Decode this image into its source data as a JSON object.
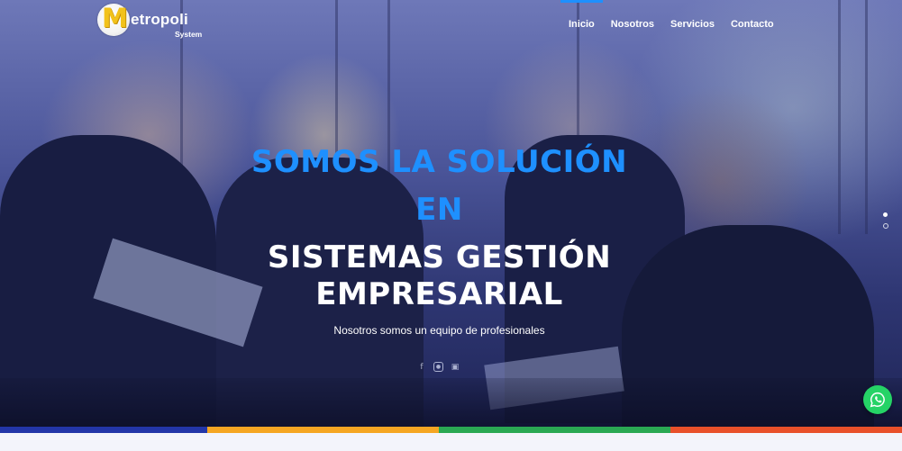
{
  "brand": {
    "logo_letter": "M",
    "name": "etropoli",
    "subtitle": "System"
  },
  "nav": {
    "items": [
      {
        "label": "Inicio",
        "active": true
      },
      {
        "label": "Nosotros",
        "active": false
      },
      {
        "label": "Servicios",
        "active": false
      },
      {
        "label": "Contacto",
        "active": false
      }
    ],
    "active_color": "#1e90ff"
  },
  "hero": {
    "line1": "SOMOS LA SOLUCIÓN",
    "line2": "EN",
    "line3": "SISTEMAS GESTIÓN",
    "line4": "EMPRESARIAL",
    "tagline": "Nosotros somos un equipo de profesionales",
    "accent_color": "#1e90ff",
    "social_icons": [
      "facebook-icon",
      "instagram-icon",
      "youtube-icon"
    ]
  },
  "slider": {
    "slide_count": 2,
    "active_slide": 1
  },
  "whatsapp": {
    "icon": "whatsapp-icon",
    "color": "#25d366"
  },
  "footer_stripe": {
    "colors": [
      "#2336a8",
      "#f5a623",
      "#2aa853",
      "#e8502a"
    ]
  }
}
